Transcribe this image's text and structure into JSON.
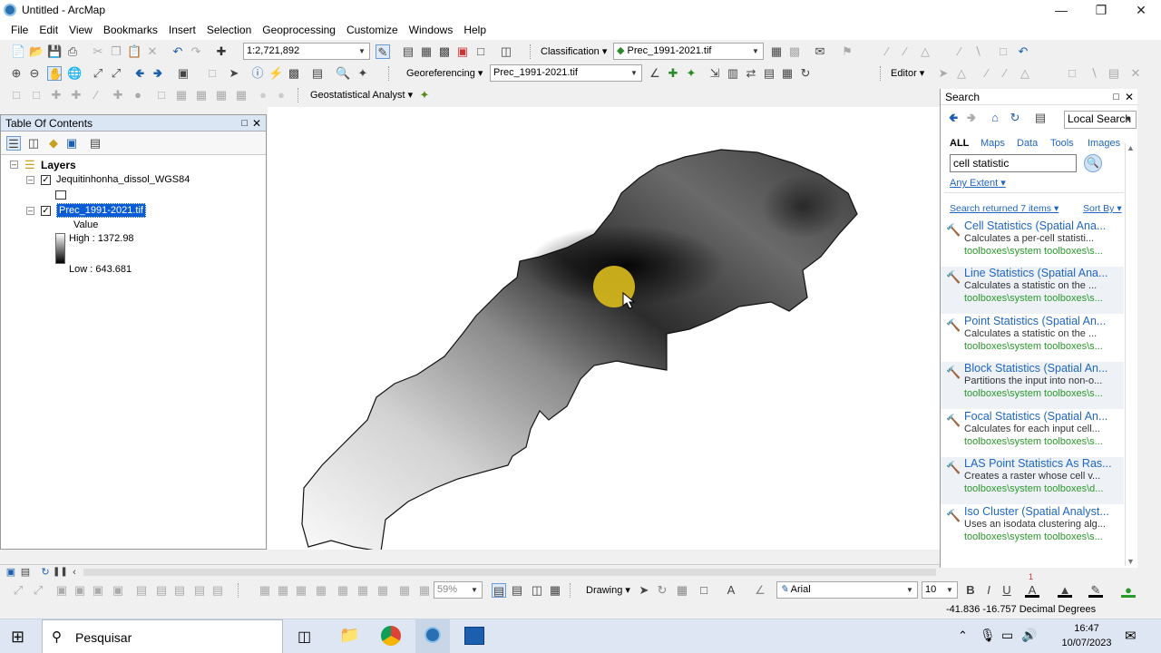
{
  "window": {
    "title": "Untitled - ArcMap"
  },
  "menu": [
    "File",
    "Edit",
    "View",
    "Bookmarks",
    "Insert",
    "Selection",
    "Geoprocessing",
    "Customize",
    "Windows",
    "Help"
  ],
  "toolbar1": {
    "scale": "1:2,721,892",
    "classification_label": "Classification",
    "layer_combo": "Prec_1991-2021.tif"
  },
  "toolbar2": {
    "georef_label": "Georeferencing",
    "georef_combo": "Prec_1991-2021.tif",
    "editor_label": "Editor"
  },
  "toolbar3": {
    "geostat_label": "Geostatistical Analyst"
  },
  "toc": {
    "title": "Table Of Contents",
    "root": "Layers",
    "layer1": "Jequitinhonha_dissol_WGS84",
    "layer2": "Prec_1991-2021.tif",
    "legend_field": "Value",
    "high": "High : 1372.98",
    "low": "Low : 643.681"
  },
  "search": {
    "title": "Search",
    "scope": "Local Search",
    "tabs": [
      "ALL",
      "Maps",
      "Data",
      "Tools",
      "Images"
    ],
    "query": "cell statistic",
    "extent": "Any Extent",
    "returned": "Search returned 7 items",
    "sort": "Sort By",
    "results": [
      {
        "name": "Cell Statistics (Spatial Ana...",
        "desc": "Calculates a per-cell statisti...",
        "path": "toolboxes\\system toolboxes\\s..."
      },
      {
        "name": "Line Statistics (Spatial Ana...",
        "desc": "Calculates a statistic on the ...",
        "path": "toolboxes\\system toolboxes\\s..."
      },
      {
        "name": "Point Statistics (Spatial An...",
        "desc": "Calculates a statistic on the ...",
        "path": "toolboxes\\system toolboxes\\s..."
      },
      {
        "name": "Block Statistics (Spatial An...",
        "desc": "Partitions the input into non-o...",
        "path": "toolboxes\\system toolboxes\\s..."
      },
      {
        "name": "Focal Statistics (Spatial An...",
        "desc": "Calculates for each input cell...",
        "path": "toolboxes\\system toolboxes\\s..."
      },
      {
        "name": "LAS Point Statistics As Ras...",
        "desc": "Creates a raster whose cell v...",
        "path": "toolboxes\\system toolboxes\\d..."
      },
      {
        "name": "Iso Cluster (Spatial Analyst...",
        "desc": "Uses an isodata clustering alg...",
        "path": "toolboxes\\system toolboxes\\s..."
      }
    ]
  },
  "drawing": {
    "zoom": "59%",
    "drawing_label": "Drawing",
    "font": "Arial",
    "size": "10",
    "page_num": "1"
  },
  "status": {
    "coords": "-41.836  -16.757 Decimal Degrees"
  },
  "taskbar": {
    "search": "Pesquisar",
    "time": "16:47",
    "date": "10/07/2023"
  }
}
